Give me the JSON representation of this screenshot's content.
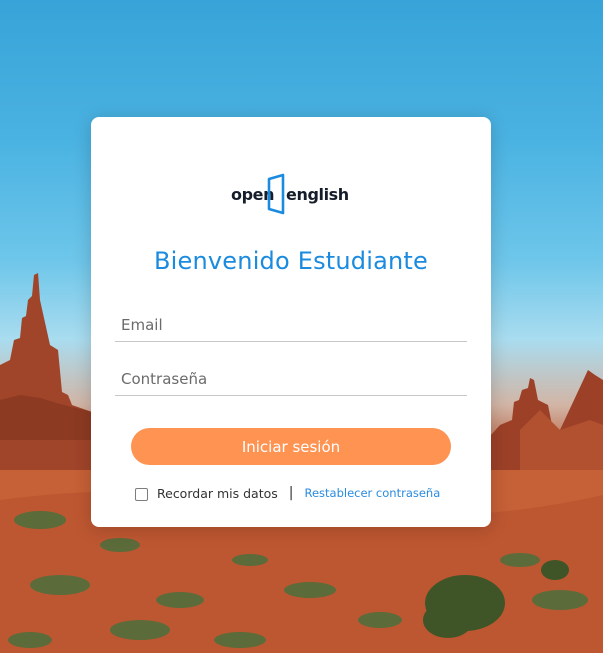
{
  "brand": {
    "logo_word_left": "open",
    "logo_word_right": "english",
    "logo_accent_color": "#1a8bdf",
    "logo_text_color": "#151d2b"
  },
  "login": {
    "welcome_title": "Bienvenido Estudiante",
    "email_placeholder": "Email",
    "password_placeholder": "Contraseña",
    "submit_label": "Iniciar sesión",
    "remember_label": "Recordar mis datos",
    "remember_checked": false,
    "separator": "|",
    "reset_link": "Restablecer contraseña"
  },
  "theme": {
    "accent_blue": "#1a8bdf",
    "button_orange": "#fe9352"
  }
}
